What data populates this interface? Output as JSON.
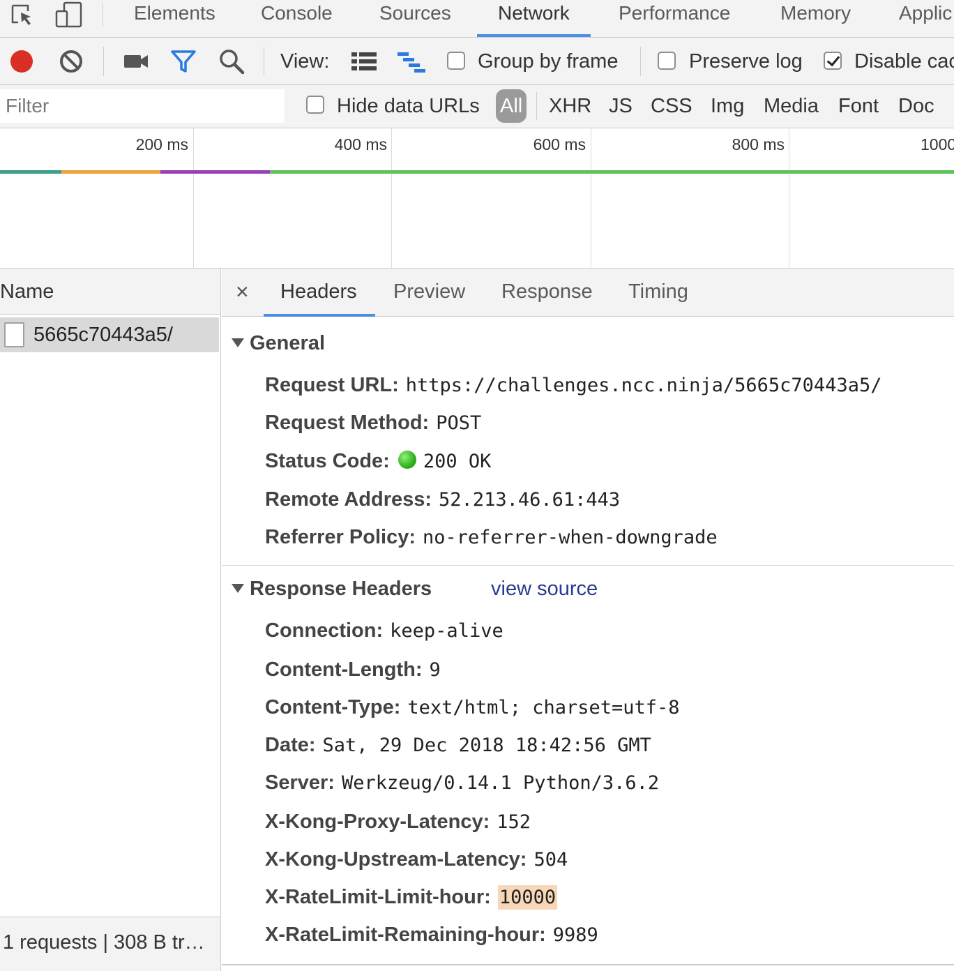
{
  "tabs": {
    "items": [
      "Elements",
      "Console",
      "Sources",
      "Network",
      "Performance",
      "Memory",
      "Applic"
    ],
    "active": "Network"
  },
  "toolbar": {
    "view_label": "View:",
    "group_by_frame": {
      "label": "Group by frame",
      "checked": false
    },
    "preserve_log": {
      "label": "Preserve log",
      "checked": false
    },
    "disable_cache": {
      "label": "Disable cac",
      "checked": true
    },
    "record_color": "#d93025"
  },
  "filter": {
    "placeholder": "Filter",
    "hide_data_urls": {
      "label": "Hide data URLs",
      "checked": false
    },
    "types": [
      "All",
      "XHR",
      "JS",
      "CSS",
      "Img",
      "Media",
      "Font",
      "Doc"
    ],
    "active_type": "All"
  },
  "timeline": {
    "ticks": [
      "200 ms",
      "400 ms",
      "600 ms",
      "800 ms",
      "1000"
    ],
    "bar_colors": [
      "#3e9e8a",
      "#f0a23b",
      "#9a3fb5",
      "#5dc35b"
    ]
  },
  "requests": {
    "column": "Name",
    "items": [
      {
        "name": "5665c70443a5/"
      }
    ],
    "summary": "1 requests | 308 B tr…"
  },
  "detail": {
    "tabs": [
      "Headers",
      "Preview",
      "Response",
      "Timing"
    ],
    "active_tab": "Headers",
    "close_glyph": "×",
    "general": {
      "title": "General",
      "rows": [
        {
          "key": "Request URL:",
          "value": "https://challenges.ncc.ninja/5665c70443a5/"
        },
        {
          "key": "Request Method:",
          "value": "POST"
        },
        {
          "key": "Status Code:",
          "value": "200 OK",
          "status_color": "#2fb11c"
        },
        {
          "key": "Remote Address:",
          "value": "52.213.46.61:443"
        },
        {
          "key": "Referrer Policy:",
          "value": "no-referrer-when-downgrade"
        }
      ]
    },
    "response_headers": {
      "title": "Response Headers",
      "view_source": "view source",
      "rows": [
        {
          "key": "Connection:",
          "value": "keep-alive"
        },
        {
          "key": "Content-Length:",
          "value": "9"
        },
        {
          "key": "Content-Type:",
          "value": "text/html; charset=utf-8"
        },
        {
          "key": "Date:",
          "value": "Sat, 29 Dec 2018 18:42:56 GMT"
        },
        {
          "key": "Server:",
          "value": "Werkzeug/0.14.1 Python/3.6.2"
        },
        {
          "key": "X-Kong-Proxy-Latency:",
          "value": "152"
        },
        {
          "key": "X-Kong-Upstream-Latency:",
          "value": "504"
        },
        {
          "key": "X-RateLimit-Limit-hour:",
          "value": "10000",
          "highlight": true
        },
        {
          "key": "X-RateLimit-Remaining-hour:",
          "value": "9989"
        }
      ]
    }
  }
}
